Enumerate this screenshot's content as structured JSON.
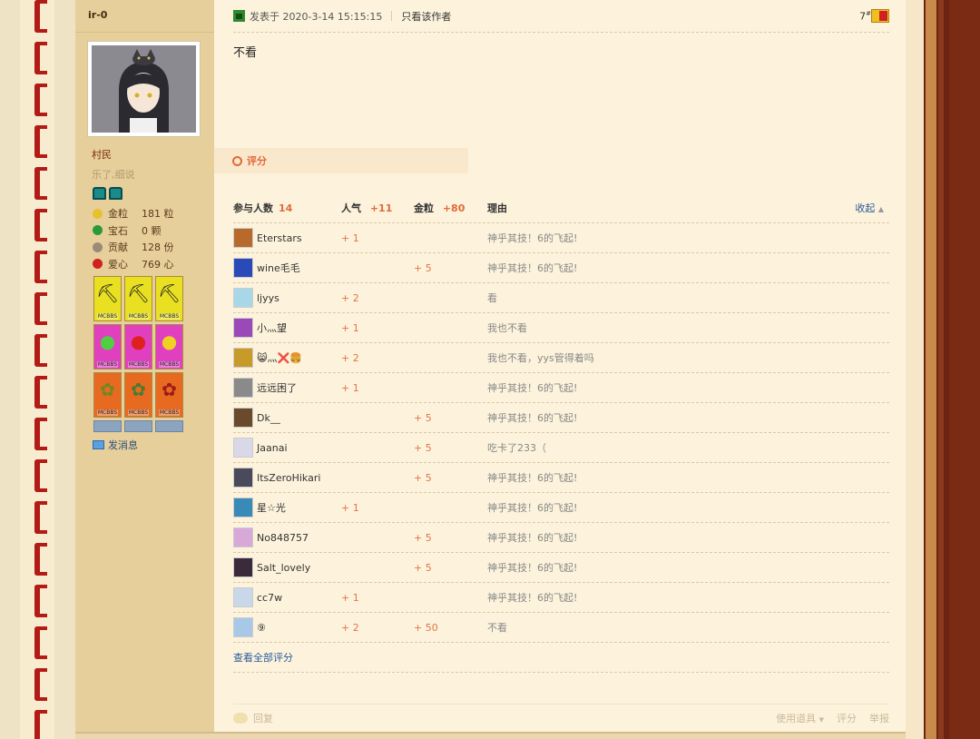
{
  "author": {
    "name": "ir-0",
    "group": "村民",
    "signature": "乐了,细说",
    "stats": [
      {
        "label": "金粒",
        "value": "181 粒",
        "icon": "gold-nugget-icon",
        "color": "#e8c030"
      },
      {
        "label": "宝石",
        "value": "0 颗",
        "icon": "emerald-icon",
        "color": "#2a9a3a"
      },
      {
        "label": "贡献",
        "value": "128 份",
        "icon": "contribution-icon",
        "color": "#9a8a78"
      },
      {
        "label": "爱心",
        "value": "769 心",
        "icon": "apple-heart-icon",
        "color": "#d02020"
      }
    ],
    "badges": [
      {
        "icon": "pickaxe-icon",
        "bg": "#e8e020",
        "glyph": "⛏",
        "text": "MCBBS"
      },
      {
        "icon": "pickaxe-icon",
        "bg": "#e8e020",
        "glyph": "⛏",
        "text": "MCBBS"
      },
      {
        "icon": "pickaxe-icon",
        "bg": "#e8e020",
        "glyph": "⛏",
        "text": "MCBBS"
      },
      {
        "icon": "green-apple-icon",
        "bg": "#e040c0",
        "glyph": "●",
        "text": "MCBBS",
        "glyphColor": "#50d040"
      },
      {
        "icon": "red-apple-icon",
        "bg": "#e040c0",
        "glyph": "●",
        "text": "MCBBS",
        "glyphColor": "#e02020"
      },
      {
        "icon": "gold-apple-icon",
        "bg": "#e040c0",
        "glyph": "●",
        "text": "MCBBS",
        "glyphColor": "#f0d020"
      },
      {
        "icon": "vine-icon",
        "bg": "#e86a20",
        "glyph": "✿",
        "text": "MCBBS",
        "glyphColor": "#6a8a20"
      },
      {
        "icon": "leaves-icon",
        "bg": "#e86a20",
        "glyph": "✿",
        "text": "MCBBS",
        "glyphColor": "#4a7a30"
      },
      {
        "icon": "netherwart-icon",
        "bg": "#e86a20",
        "glyph": "✿",
        "text": "MCBBS",
        "glyphColor": "#a01a1a"
      }
    ],
    "send_message": "发消息"
  },
  "post": {
    "date": "发表于 2020-3-14 15:15:15",
    "only_author": "只看该作者",
    "floor": "7",
    "floor_suffix": "#",
    "content": "不看"
  },
  "rating": {
    "tab_label": "评分",
    "header": {
      "participants_label": "参与人数",
      "participants": "14",
      "popularity_label": "人气",
      "popularity": "+11",
      "gold_label": "金粒",
      "gold": "+80",
      "reason_label": "理由",
      "collapse": "收起"
    },
    "rows": [
      {
        "user": "Eterstars",
        "pop": "+ 1",
        "gold": "",
        "reason": "神乎其技！6的飞起!",
        "avatar": "#b86a2a"
      },
      {
        "user": "wine毛毛",
        "pop": "",
        "gold": "+ 5",
        "reason": "神乎其技！6的飞起!",
        "avatar": "#2a4ab8"
      },
      {
        "user": "ljyys",
        "pop": "+ 2",
        "gold": "",
        "reason": "看",
        "avatar": "#a8d8e8"
      },
      {
        "user": "小灬望",
        "pop": "+ 1",
        "gold": "",
        "reason": "我也不看",
        "avatar": "#9a4ab8"
      },
      {
        "user": "😸灬❌🍔",
        "pop": "+ 2",
        "gold": "",
        "reason": "我也不看，yys管得着吗",
        "avatar": "#c89a2a"
      },
      {
        "user": "远远困了",
        "pop": "+ 1",
        "gold": "",
        "reason": "神乎其技！6的飞起!",
        "avatar": "#8a8a8a"
      },
      {
        "user": "Dk__",
        "pop": "",
        "gold": "+ 5",
        "reason": "神乎其技！6的飞起!",
        "avatar": "#6a4a2a"
      },
      {
        "user": "Jaanai",
        "pop": "",
        "gold": "+ 5",
        "reason": "吃卡了233（",
        "avatar": "#d8d8e8"
      },
      {
        "user": "ItsZeroHikari",
        "pop": "",
        "gold": "+ 5",
        "reason": "神乎其技！6的飞起!",
        "avatar": "#4a4a5a"
      },
      {
        "user": "星☆光",
        "pop": "+ 1",
        "gold": "",
        "reason": "神乎其技！6的飞起!",
        "avatar": "#3a8ab8"
      },
      {
        "user": "No848757",
        "pop": "",
        "gold": "+ 5",
        "reason": "神乎其技！6的飞起!",
        "avatar": "#d8a8d8"
      },
      {
        "user": "Salt_lovely",
        "pop": "",
        "gold": "+ 5",
        "reason": "神乎其技！6的飞起!",
        "avatar": "#3a2a3a"
      },
      {
        "user": "cc7w",
        "pop": "+ 1",
        "gold": "",
        "reason": "神乎其技！6的飞起!",
        "avatar": "#c8d8e8"
      },
      {
        "user": "⑨",
        "pop": "+ 2",
        "gold": "+ 50",
        "reason": "不看",
        "avatar": "#a8c8e8"
      }
    ],
    "view_all": "查看全部评分"
  },
  "footer": {
    "reply": "回复",
    "use_item": "使用道具",
    "rate": "评分",
    "report": "举报"
  }
}
